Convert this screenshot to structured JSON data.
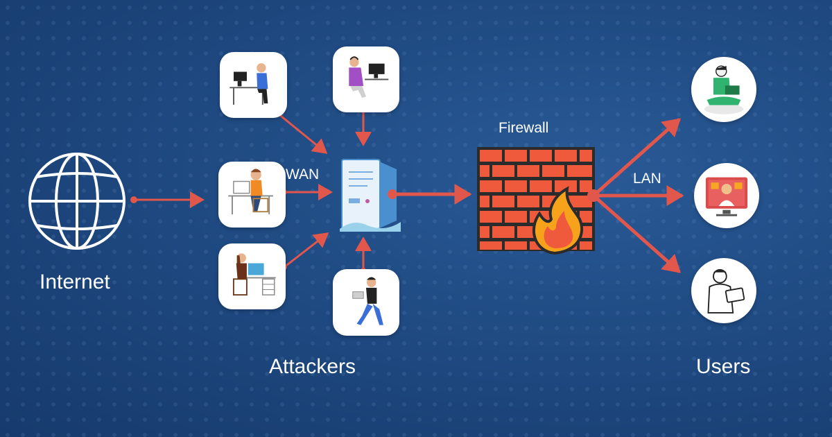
{
  "labels": {
    "internet": "Internet",
    "attackers": "Attackers",
    "users": "Users",
    "firewall": "Firewall",
    "wan": "WAN",
    "lan": "LAN"
  },
  "icons": {
    "internet": "globe-icon",
    "server": "server-icon",
    "firewall": "brick-wall-fire-icon",
    "attackers": [
      "person-at-desktop-icon",
      "person-with-headset-icon",
      "person-at-desk-icon",
      "woman-at-desk-icon",
      "person-with-laptop-icon"
    ],
    "users": [
      "person-with-laptop-icon",
      "people-on-screen-icon",
      "man-with-laptop-icon"
    ]
  },
  "colors": {
    "background": "#1f4a82",
    "arrow": "#e2574c",
    "brick": "#f05a3c",
    "mortar": "#2b2b2b",
    "flame": "#f6a21b",
    "text": "#ffffff"
  }
}
